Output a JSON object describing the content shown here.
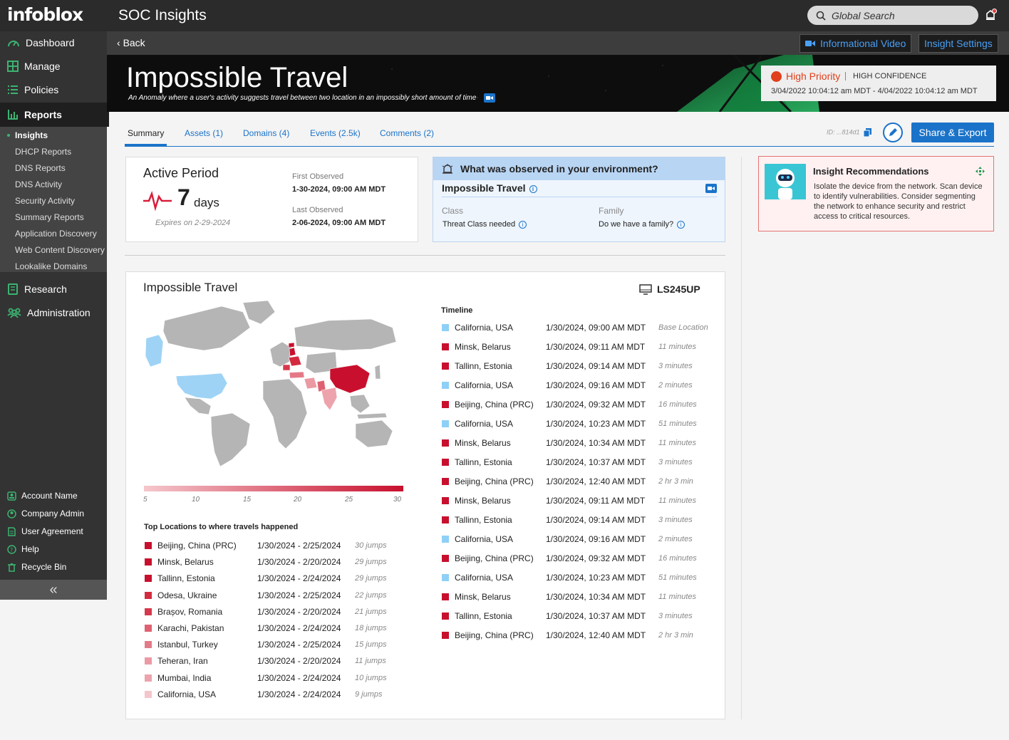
{
  "app": {
    "logo": "infoblox",
    "title": "SOC Insights"
  },
  "search": {
    "placeholder": "Global Search"
  },
  "sidebar": {
    "main": [
      {
        "label": "Dashboard",
        "icon": "dashboard-icon"
      },
      {
        "label": "Manage",
        "icon": "grid-icon"
      },
      {
        "label": "Policies",
        "icon": "list-icon"
      },
      {
        "label": "Reports",
        "icon": "chart-icon"
      }
    ],
    "reports_sub": [
      "Insights",
      "DHCP Reports",
      "DNS Reports",
      "DNS Activity",
      "Security Activity",
      "Summary Reports",
      "Application Discovery",
      "Web Content Discovery",
      "Lookalike Domains"
    ],
    "lower": [
      {
        "label": "Research",
        "icon": "book-icon"
      },
      {
        "label": "Administration",
        "icon": "users-icon"
      }
    ],
    "bottom": [
      {
        "label": "Account Name",
        "icon": "account-icon"
      },
      {
        "label": "Company Admin",
        "icon": "admin-icon"
      },
      {
        "label": "User Agreement",
        "icon": "doc-icon"
      },
      {
        "label": "Help",
        "icon": "help-icon"
      },
      {
        "label": "Recycle Bin",
        "icon": "trash-icon"
      }
    ],
    "collapse": "«"
  },
  "subbar": {
    "back": "Back",
    "video_btn": "Informational Video",
    "settings_btn": "Insight Settings"
  },
  "banner": {
    "title": "Impossible Travel",
    "subtitle": "An Anomaly where a user's activity suggests travel between two location in an impossibly short amount of time",
    "priority": "High Priority",
    "confidence": "HIGH CONFIDENCE",
    "dates": "3/04/2022 10:04:12 am MDT - 4/04/2022 10:04:12 am MDT",
    "colors": {
      "priority": "#e0401c"
    }
  },
  "tabs": [
    "Summary",
    "Assets (1)",
    "Domains (4)",
    "Events (2.5k)",
    "Comments (2)"
  ],
  "id_text": "ID: ...814d1",
  "share_btn": "Share & Export",
  "active_period": {
    "title": "Active Period",
    "days": "7",
    "unit": "days",
    "expires": "Expires on 2-29-2024",
    "first_label": "First Observed",
    "first_value": "1-30-2024, 09:00 AM MDT",
    "last_label": "Last Observed",
    "last_value": "2-06-2024, 09:00 AM MDT"
  },
  "env": {
    "heading": "What was observed in your environment?",
    "name": "Impossible Travel",
    "class_label": "Class",
    "class_value": "Threat Class needed",
    "family_label": "Family",
    "family_value": "Do we have a family?"
  },
  "recommend": {
    "title": "Insight Recommendations",
    "body": "Isolate the device from the network. Scan device to identify vulnerabilities. Consider segmenting the network to enhance security and restrict access to critical resources."
  },
  "map": {
    "title": "Impossible Travel",
    "device": "LS245UP",
    "legend": [
      "5",
      "10",
      "15",
      "20",
      "25",
      "30"
    ],
    "top_title": "Top Locations to where travels happened",
    "top_locations": [
      {
        "loc": "Beijing, China (PRC)",
        "range": "1/30/2024 - 2/25/2024",
        "jumps": "30 jumps",
        "color": "#c8102e"
      },
      {
        "loc": "Minsk, Belarus",
        "range": "1/30/2024 - 2/20/2024",
        "jumps": "29 jumps",
        "color": "#c8102e"
      },
      {
        "loc": "Tallinn, Estonia",
        "range": "1/30/2024 - 2/24/2024",
        "jumps": "29 jumps",
        "color": "#c8102e"
      },
      {
        "loc": "Odesa, Ukraine",
        "range": "1/30/2024 - 2/25/2024",
        "jumps": "22 jumps",
        "color": "#d42a40"
      },
      {
        "loc": "Brașov, Romania",
        "range": "1/30/2024 - 2/20/2024",
        "jumps": "21 jumps",
        "color": "#d6384d"
      },
      {
        "loc": "Karachi, Pakistan",
        "range": "1/30/2024 - 2/24/2024",
        "jumps": "18 jumps",
        "color": "#de6272"
      },
      {
        "loc": "Istanbul, Turkey",
        "range": "1/30/2024 - 2/25/2024",
        "jumps": "15 jumps",
        "color": "#e47a88"
      },
      {
        "loc": "Teheran, Iran",
        "range": "1/30/2024 - 2/20/2024",
        "jumps": "11 jumps",
        "color": "#eb9aa4"
      },
      {
        "loc": "Mumbai, India",
        "range": "1/30/2024 - 2/24/2024",
        "jumps": "10 jumps",
        "color": "#eda3ac"
      },
      {
        "loc": "California, USA",
        "range": "1/30/2024 - 2/24/2024",
        "jumps": "9 jumps",
        "color": "#f4c5cb"
      }
    ]
  },
  "timeline": {
    "title": "Timeline",
    "rows": [
      {
        "loc": "California, USA",
        "time": "1/30/2024, 09:00 AM MDT",
        "delta": "Base Location",
        "color": "#8fd0f7"
      },
      {
        "loc": "Minsk, Belarus",
        "time": "1/30/2024, 09:11 AM MDT",
        "delta": "11 minutes",
        "color": "#c8102e"
      },
      {
        "loc": "Tallinn, Estonia",
        "time": "1/30/2024, 09:14 AM MDT",
        "delta": "3 minutes",
        "color": "#c8102e"
      },
      {
        "loc": "California, USA",
        "time": "1/30/2024, 09:16 AM MDT",
        "delta": "2 minutes",
        "color": "#8fd0f7"
      },
      {
        "loc": "Beijing, China (PRC)",
        "time": "1/30/2024, 09:32 AM MDT",
        "delta": "16 minutes",
        "color": "#c8102e"
      },
      {
        "loc": "California, USA",
        "time": "1/30/2024, 10:23 AM MDT",
        "delta": "51 minutes",
        "color": "#8fd0f7"
      },
      {
        "loc": "Minsk, Belarus",
        "time": "1/30/2024, 10:34 AM MDT",
        "delta": "11 minutes",
        "color": "#c8102e"
      },
      {
        "loc": "Tallinn, Estonia",
        "time": "1/30/2024, 10:37 AM MDT",
        "delta": "3 minutes",
        "color": "#c8102e"
      },
      {
        "loc": "Beijing, China (PRC)",
        "time": "1/30/2024, 12:40 AM MDT",
        "delta": "2 hr 3 min",
        "color": "#c8102e"
      },
      {
        "loc": "Minsk, Belarus",
        "time": "1/30/2024, 09:11 AM MDT",
        "delta": "11 minutes",
        "color": "#c8102e"
      },
      {
        "loc": "Tallinn, Estonia",
        "time": "1/30/2024, 09:14 AM MDT",
        "delta": "3 minutes",
        "color": "#c8102e"
      },
      {
        "loc": "California, USA",
        "time": "1/30/2024, 09:16 AM MDT",
        "delta": "2 minutes",
        "color": "#8fd0f7"
      },
      {
        "loc": "Beijing, China (PRC)",
        "time": "1/30/2024, 09:32 AM MDT",
        "delta": "16 minutes",
        "color": "#c8102e"
      },
      {
        "loc": "California, USA",
        "time": "1/30/2024, 10:23 AM MDT",
        "delta": "51 minutes",
        "color": "#8fd0f7"
      },
      {
        "loc": "Minsk, Belarus",
        "time": "1/30/2024, 10:34 AM MDT",
        "delta": "11 minutes",
        "color": "#c8102e"
      },
      {
        "loc": "Tallinn, Estonia",
        "time": "1/30/2024, 10:37 AM MDT",
        "delta": "3 minutes",
        "color": "#c8102e"
      },
      {
        "loc": "Beijing, China (PRC)",
        "time": "1/30/2024, 12:40 AM MDT",
        "delta": "2 hr 3 min",
        "color": "#c8102e"
      }
    ]
  }
}
